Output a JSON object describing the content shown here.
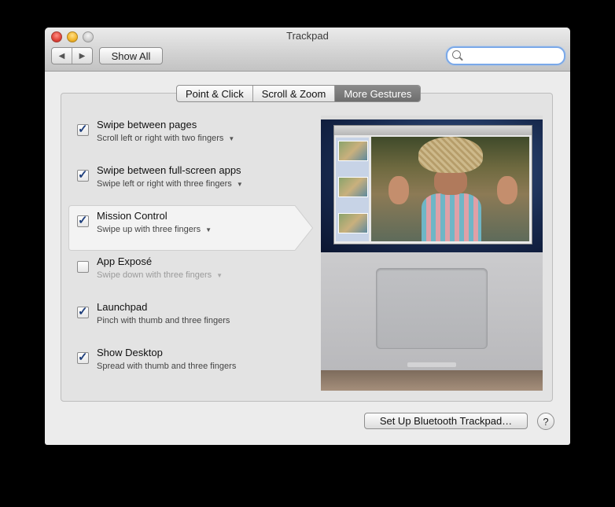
{
  "window": {
    "title": "Trackpad"
  },
  "toolbar": {
    "back": "◀",
    "forward": "▶",
    "show_all_label": "Show All",
    "search_placeholder": ""
  },
  "tabs": [
    {
      "label": "Point & Click"
    },
    {
      "label": "Scroll & Zoom"
    },
    {
      "label": "More Gestures",
      "active": true
    }
  ],
  "gestures": [
    {
      "title": "Swipe between pages",
      "subtitle": "Scroll left or right with two fingers",
      "checked": true,
      "has_menu": true
    },
    {
      "title": "Swipe between full-screen apps",
      "subtitle": "Swipe left or right with three fingers",
      "checked": true,
      "has_menu": true
    },
    {
      "title": "Mission Control",
      "subtitle": "Swipe up with three fingers",
      "checked": true,
      "has_menu": true,
      "selected": true
    },
    {
      "title": "App Exposé",
      "subtitle": "Swipe down with three fingers",
      "checked": false,
      "has_menu": true
    },
    {
      "title": "Launchpad",
      "subtitle": "Pinch with thumb and three fingers",
      "checked": true,
      "has_menu": false
    },
    {
      "title": "Show Desktop",
      "subtitle": "Spread with thumb and three fingers",
      "checked": true,
      "has_menu": false
    }
  ],
  "menu_arrow": "▼",
  "footer": {
    "bluetooth_label": "Set Up Bluetooth Trackpad…",
    "help_label": "?"
  }
}
